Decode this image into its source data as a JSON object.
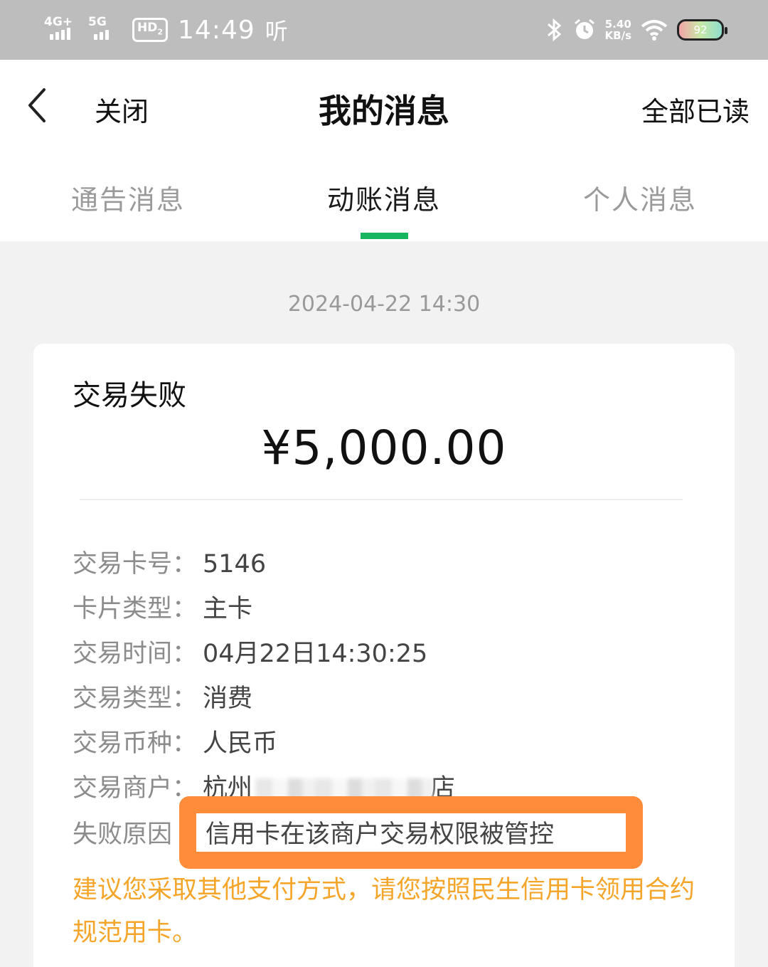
{
  "status_bar": {
    "network1": "4G+",
    "network2": "5G",
    "hd": "HD",
    "hd_sub": "2",
    "time": "14:49",
    "listen": "听",
    "speed_value": "5.40",
    "speed_unit": "KB/s",
    "battery": "92"
  },
  "nav": {
    "back_icon": "chevron-left-icon",
    "close_label": "关闭",
    "title": "我的消息",
    "read_all_label": "全部已读"
  },
  "tabs": [
    {
      "label": "通告消息",
      "active": false
    },
    {
      "label": "动账消息",
      "active": true
    },
    {
      "label": "个人消息",
      "active": false
    }
  ],
  "accent_color": "#17b560",
  "message": {
    "time": "2024-04-22 14:30",
    "title": "交易失败",
    "amount": "¥5,000.00",
    "fields": [
      {
        "label": "交易卡号：",
        "value": "5146"
      },
      {
        "label": "卡片类型：",
        "value": "主卡"
      },
      {
        "label": "交易时间：",
        "value": "04月22日14:30:25"
      },
      {
        "label": "交易类型：",
        "value": "消费"
      },
      {
        "label": "交易币种：",
        "value": "人民币"
      },
      {
        "label": "交易商户：",
        "value": "杭州",
        "value_tail": "店"
      }
    ],
    "reason_label": "失败原因",
    "reason_value": "信用卡在该商户交易权限被管控",
    "advice": "建议您采取其他支付方式，请您按照民生信用卡领用合约规范用卡。",
    "advice_color": "#f4a52a",
    "highlight_color": "#ff8c3a"
  }
}
